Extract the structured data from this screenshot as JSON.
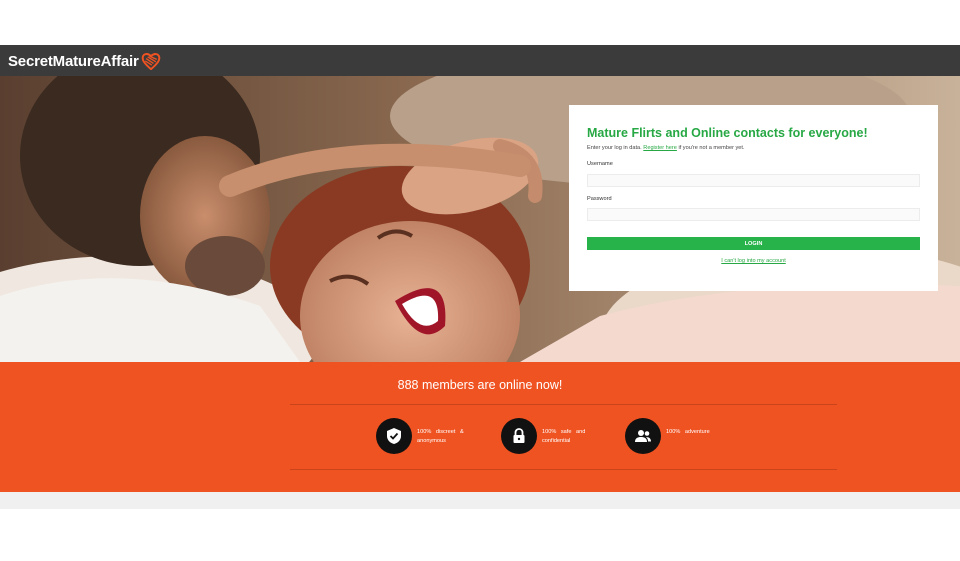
{
  "header": {
    "logo_text": "SecretMatureAffair",
    "logo_icon": "heart-icon",
    "background_color": "#3b3b3b",
    "accent_color": "#f05322"
  },
  "login": {
    "title": "Mature Flirts and Online contacts for everyone!",
    "subtitle_prefix": "Enter your log in data.",
    "register_link": "Register here",
    "subtitle_suffix": "if you're not a member yet.",
    "username_label": "Username",
    "username_value": "",
    "password_label": "Password",
    "password_value": "",
    "login_button": "LOGIN",
    "cant_login_link": "I can't log into my account",
    "accent_color": "#27a844"
  },
  "stats": {
    "online_text": "888 members are online now!",
    "band_color": "#f05322"
  },
  "features": [
    {
      "icon": "shield-check-icon",
      "text": "100% discreet & anonymous"
    },
    {
      "icon": "lock-icon",
      "text": "100% safe and confidential"
    },
    {
      "icon": "people-icon",
      "text": "100% adventure"
    }
  ]
}
